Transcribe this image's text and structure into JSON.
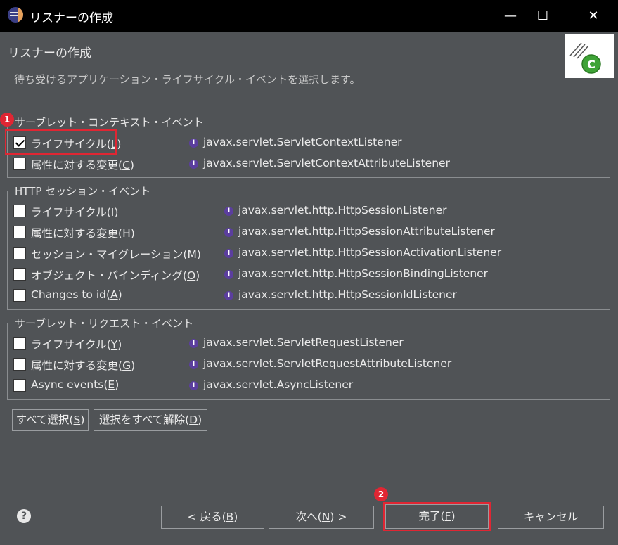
{
  "window": {
    "title": "リスナーの作成",
    "minimize_glyph": "—",
    "maximize_glyph": "☐",
    "close_glyph": "✕"
  },
  "header": {
    "title": "リスナーの作成",
    "description": "待ち受けるアプリケーション・ライフサイクル・イベントを選択します。",
    "image_letter": "C"
  },
  "groups": [
    {
      "title": "サーブレット・コンテキスト・イベント",
      "items": [
        {
          "label": "ライフサイクル(",
          "mnemonic": "L",
          "suffix": ")",
          "checked": true,
          "interface": "javax.servlet.ServletContextListener"
        },
        {
          "label": "属性に対する変更(",
          "mnemonic": "C",
          "suffix": ")",
          "checked": false,
          "interface": "javax.servlet.ServletContextAttributeListener"
        }
      ]
    },
    {
      "title": "HTTP セッション・イベント",
      "items": [
        {
          "label": "ライフサイクル(",
          "mnemonic": "I",
          "suffix": ")",
          "checked": false,
          "interface": "javax.servlet.http.HttpSessionListener"
        },
        {
          "label": "属性に対する変更(",
          "mnemonic": "H",
          "suffix": ")",
          "checked": false,
          "interface": "javax.servlet.http.HttpSessionAttributeListener"
        },
        {
          "label": "セッション・マイグレーション(",
          "mnemonic": "M",
          "suffix": ")",
          "checked": false,
          "interface": "javax.servlet.http.HttpSessionActivationListener"
        },
        {
          "label": "オブジェクト・バインディング(",
          "mnemonic": "O",
          "suffix": ")",
          "checked": false,
          "interface": "javax.servlet.http.HttpSessionBindingListener"
        },
        {
          "label": "Changes to id(",
          "mnemonic": "A",
          "suffix": ")",
          "checked": false,
          "interface": "javax.servlet.http.HttpSessionIdListener"
        }
      ]
    },
    {
      "title": "サーブレット・リクエスト・イベント",
      "items": [
        {
          "label": "ライフサイクル(",
          "mnemonic": "Y",
          "suffix": ")",
          "checked": false,
          "interface": "javax.servlet.ServletRequestListener"
        },
        {
          "label": "属性に対する変更(",
          "mnemonic": "G",
          "suffix": ")",
          "checked": false,
          "interface": "javax.servlet.ServletRequestAttributeListener"
        },
        {
          "label": "Async events(",
          "mnemonic": "E",
          "suffix": ")",
          "checked": false,
          "interface": "javax.servlet.AsyncListener"
        }
      ]
    }
  ],
  "interface_icon_glyph": "I",
  "select_buttons": {
    "select_all": {
      "label": "すべて選択(",
      "mnemonic": "S",
      "suffix": ")"
    },
    "deselect_all": {
      "label": "選択をすべて解除(",
      "mnemonic": "D",
      "suffix": ")"
    }
  },
  "footer": {
    "help_glyph": "?",
    "back": {
      "label": "< 戻る(",
      "mnemonic": "B",
      "suffix": ")"
    },
    "next": {
      "label": "次へ(",
      "mnemonic": "N",
      "suffix": ") >"
    },
    "finish": {
      "label": "完了(",
      "mnemonic": "F",
      "suffix": ")"
    },
    "cancel": {
      "label": "キャンセル"
    }
  },
  "annotations": {
    "badge1": "1",
    "badge2": "2",
    "color": "#e02633"
  }
}
